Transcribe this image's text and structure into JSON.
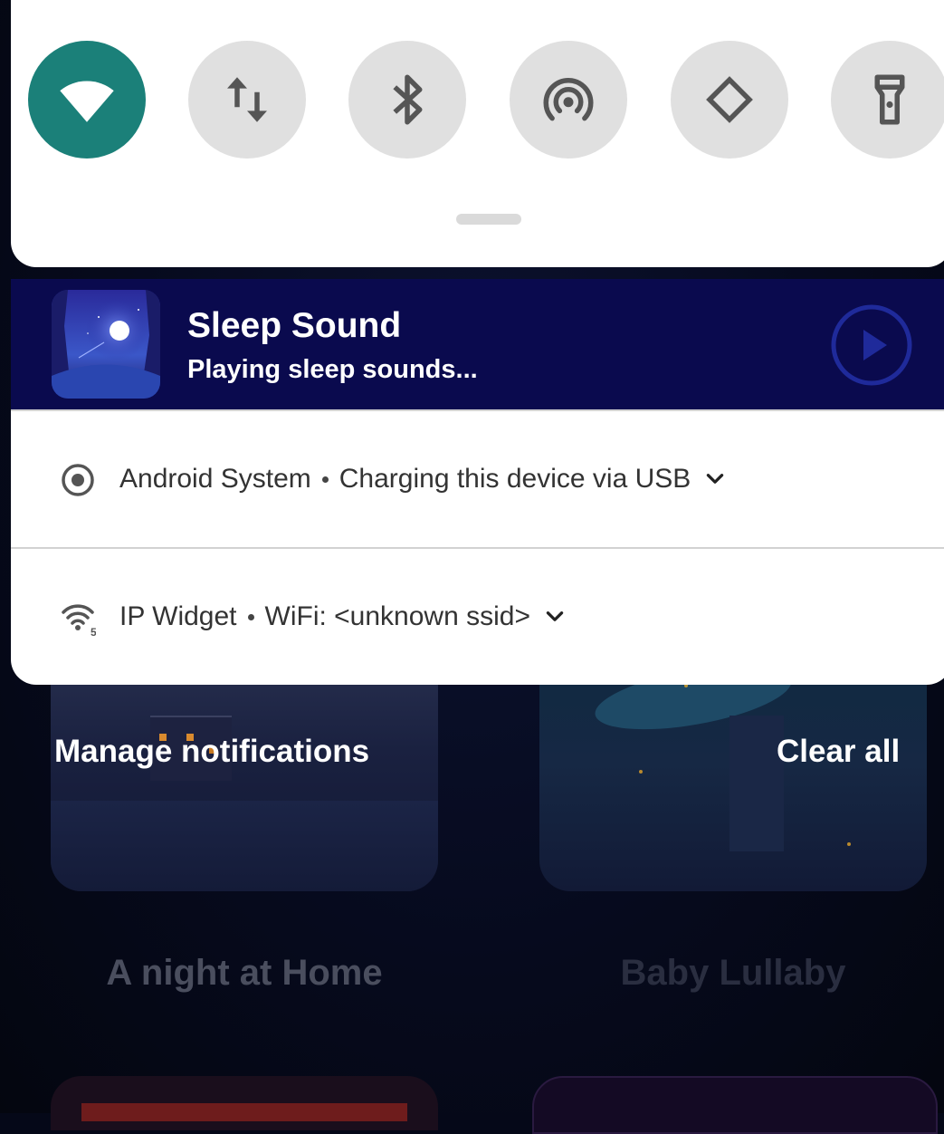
{
  "quick_settings": {
    "tiles": [
      {
        "icon": "wifi-icon",
        "active": true
      },
      {
        "icon": "mobile-data-icon",
        "active": false
      },
      {
        "icon": "bluetooth-icon",
        "active": false
      },
      {
        "icon": "hotspot-icon",
        "active": false
      },
      {
        "icon": "auto-rotate-icon",
        "active": false
      },
      {
        "icon": "flashlight-icon",
        "active": false
      }
    ]
  },
  "media": {
    "app_icon": "sleep-sound-app-icon",
    "title": "Sleep Sound",
    "subtitle": "Playing sleep sounds...",
    "action_icon": "play-icon"
  },
  "notifications": [
    {
      "icon": "android-system-icon",
      "app": "Android System",
      "text": "Charging this device via USB"
    },
    {
      "icon": "wifi-signal-icon",
      "badge": "5",
      "app": "IP Widget",
      "text": "WiFi: <unknown ssid>"
    }
  ],
  "actions": {
    "manage": "Manage notifications",
    "clear": "Clear all"
  },
  "background_app": {
    "cards": [
      "A night at Home",
      "Baby Lullaby"
    ]
  },
  "colors": {
    "active_tile": "#1b8079",
    "inactive_tile": "#e0e0e0",
    "media_background": "#0a0a4e"
  }
}
